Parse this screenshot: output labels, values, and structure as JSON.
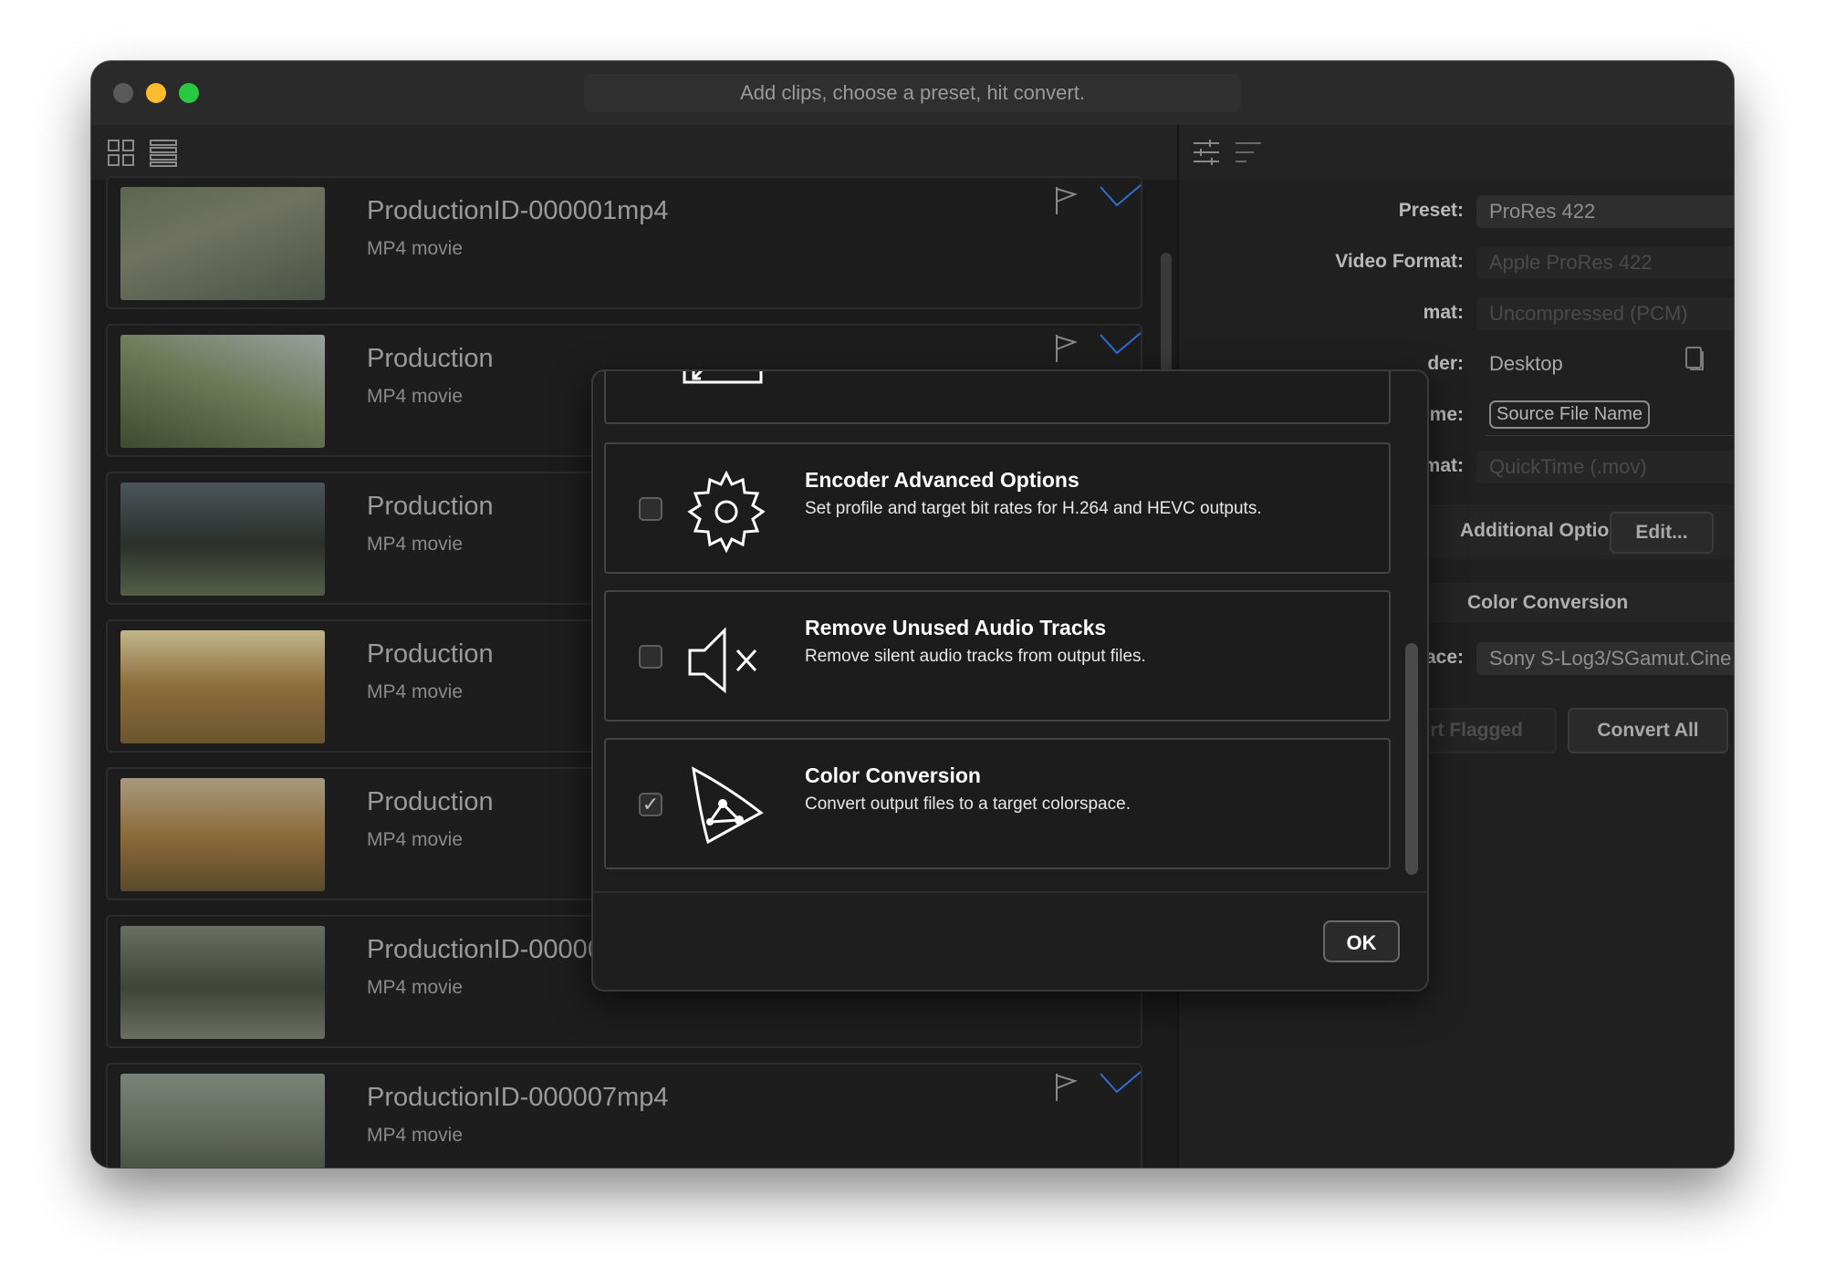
{
  "window": {
    "hint": "Add clips, choose a preset, hit convert."
  },
  "clips": [
    {
      "name": "ProductionID-000001mp4",
      "type": "MP4 movie"
    },
    {
      "name": "Production",
      "type": "MP4 movie"
    },
    {
      "name": "Production",
      "type": "MP4 movie"
    },
    {
      "name": "Production",
      "type": "MP4 movie"
    },
    {
      "name": "Production",
      "type": "MP4 movie"
    },
    {
      "name": "ProductionID-000006mp4",
      "type": "MP4 movie"
    },
    {
      "name": "ProductionID-000007mp4",
      "type": "MP4 movie"
    }
  ],
  "settings": {
    "preset_label": "Preset:",
    "preset_value": "ProRes 422",
    "video_format_label": "Video Format:",
    "video_format_value": "Apple ProRes 422",
    "audio_format_label": "mat:",
    "audio_format_value": "Uncompressed (PCM)",
    "folder_label": "der:",
    "folder_value": "Desktop",
    "name_label": "me:",
    "name_token": "Source File Name",
    "container_label": "mat:",
    "container_value": "QuickTime (.mov)",
    "additional_options": "Additional Options",
    "edit_button": "Edit...",
    "color_conversion_header": "Color Conversion",
    "colorspace_label": "ace:",
    "colorspace_value": "Sony S-Log3/SGamut.Cine",
    "convert_flagged": "Convert Flagged",
    "convert_all": "Convert All"
  },
  "modal": {
    "options": [
      {
        "title": "Encoder Advanced Options",
        "desc": "Set profile and target bit rates for H.264 and HEVC outputs.",
        "checked": false,
        "icon": "gear-icon"
      },
      {
        "title": "Remove Unused Audio Tracks",
        "desc": "Remove silent audio tracks from output files.",
        "checked": false,
        "icon": "speaker-muted-icon"
      },
      {
        "title": "Color Conversion",
        "desc": "Convert output files to a target colorspace.",
        "checked": true,
        "icon": "color-triangle-icon"
      }
    ],
    "ok": "OK"
  },
  "colors": {
    "accent_check": "#2f6fd6",
    "window_bg": "#1e1e1e",
    "yellow_light": "#febc2e",
    "green_light": "#28c840"
  }
}
